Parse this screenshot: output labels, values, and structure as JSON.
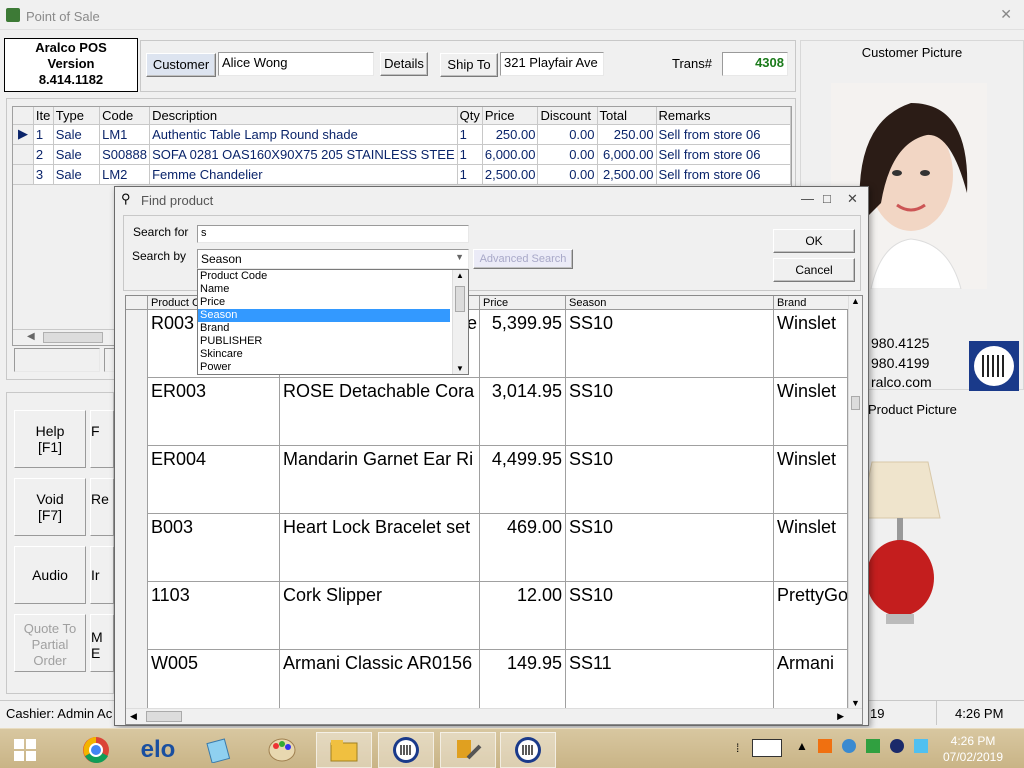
{
  "window": {
    "title": "Point of Sale"
  },
  "about": {
    "line1": "Aralco POS",
    "line2": "Version",
    "line3": "8.414.1182"
  },
  "header": {
    "customer_label": "Customer",
    "customer_name": "Alice Wong",
    "details_label": "Details",
    "shipto_label": "Ship To",
    "shipto_address": "321 Playfair Ave",
    "trans_label": "Trans#",
    "trans_value": "4308"
  },
  "grid": {
    "columns": [
      "Ite",
      "Type",
      "Code",
      "Description",
      "Qty",
      "Price",
      "Discount",
      "Total",
      "Remarks"
    ],
    "rows": [
      {
        "item": "1",
        "type": "Sale",
        "code": "LM1",
        "description": "Authentic Table Lamp Round shade",
        "qty": "1",
        "price": "250.00",
        "discount": "0.00",
        "total": "250.00",
        "remarks": "Sell from store 06"
      },
      {
        "item": "2",
        "type": "Sale",
        "code": "S00888",
        "description": "SOFA 0281 OAS160X90X75 205 STAINLESS STEE",
        "qty": "1",
        "price": "6,000.00",
        "discount": "0.00",
        "total": "6,000.00",
        "remarks": "Sell from store 06"
      },
      {
        "item": "3",
        "type": "Sale",
        "code": "LM2",
        "description": "Femme Chandelier",
        "qty": "1",
        "price": "2,500.00",
        "discount": "0.00",
        "total": "2,500.00",
        "remarks": "Sell from store 06"
      }
    ]
  },
  "right": {
    "customer_picture_label": "Customer Picture",
    "phone1": "980.4125",
    "phone2": "980.4199",
    "web": "ralco.com",
    "product_picture_label": "Product Picture"
  },
  "sidebar": {
    "help": "Help",
    "help_key": "[F1]",
    "void": "Void",
    "void_key": "[F7]",
    "void_partial": "Re",
    "audio": "Audio",
    "audio_partial": "Ir",
    "quote1": "Quote To",
    "quote2": "Partial",
    "quote3": "Order",
    "partial_f": "F",
    "partial_m": "M",
    "partial_e": "E"
  },
  "status": {
    "cashier": "Cashier: Admin Ac",
    "date_partial": "19",
    "time": "4:26 PM"
  },
  "dialog": {
    "title": "Find product",
    "search_for_label": "Search for",
    "search_for_value": "s",
    "search_by_label": "Search by",
    "search_by_value": "Season",
    "advanced_label": "Advanced Search",
    "ok_label": "OK",
    "cancel_label": "Cancel",
    "options": [
      "Product Code",
      "Name",
      "Price",
      "Season",
      "Brand",
      "PUBLISHER",
      "Skincare",
      "Power"
    ],
    "selected_option": "Season",
    "columns": [
      "Product C",
      "",
      "Price",
      "Season",
      "Brand"
    ],
    "rows": [
      {
        "code": "R003",
        "name": "",
        "name_tail": "ce",
        "price": "5,399.95",
        "season": "SS10",
        "brand": "Winslet"
      },
      {
        "code": "ER003",
        "name": "ROSE Detachable  Cora",
        "name_tail": "",
        "price": "3,014.95",
        "season": "SS10",
        "brand": "Winslet"
      },
      {
        "code": "ER004",
        "name": "Mandarin Garnet Ear Ri",
        "name_tail": "",
        "price": "4,499.95",
        "season": "SS10",
        "brand": "Winslet"
      },
      {
        "code": "B003",
        "name": "Heart Lock Bracelet set",
        "name_tail": "",
        "price": "469.00",
        "season": "SS10",
        "brand": "Winslet"
      },
      {
        "code": "1103",
        "name": "Cork Slipper",
        "name_tail": "",
        "price": "12.00",
        "season": "SS10",
        "brand": "PrettyGo"
      },
      {
        "code": "W005",
        "name": "Armani Classic AR0156",
        "name_tail": "",
        "price": "149.95",
        "season": "SS11",
        "brand": "Armani"
      }
    ]
  },
  "taskbar": {
    "time": "4:26 PM",
    "date": "07/02/2019",
    "apps": [
      "windows-start-icon",
      "chrome-icon",
      "elo-icon",
      "notepad-icon",
      "paint-icon",
      "file-explorer-icon",
      "aralco-barcode-icon",
      "settings-tool-icon",
      "aralco-pos-icon"
    ]
  }
}
